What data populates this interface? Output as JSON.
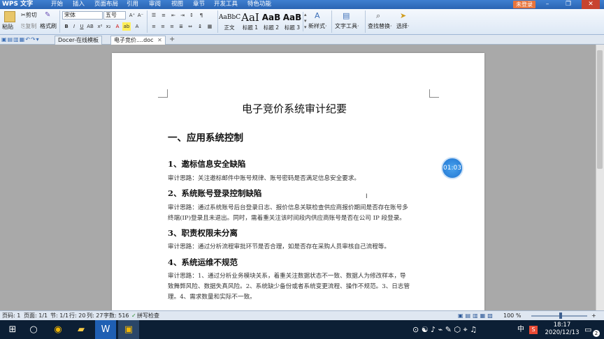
{
  "app": {
    "logo": "WPS 文字",
    "login": "未登录"
  },
  "menu": [
    "开始",
    "插入",
    "页面布局",
    "引用",
    "审阅",
    "视图",
    "章节",
    "开发工具",
    "特色功能"
  ],
  "window_controls": {
    "minimize": "–",
    "restore": "❐",
    "close": "✕"
  },
  "ribbon": {
    "paste": "粘贴",
    "cut": "剪切",
    "copy": "复制",
    "format_painter": "格式刷",
    "font_name": "宋体",
    "font_size": "五号",
    "styles": [
      {
        "preview": "AaBbC",
        "label": "正文"
      },
      {
        "preview": "AaI",
        "label": "标题 1"
      },
      {
        "preview": "AaB",
        "label": "标题 2"
      },
      {
        "preview": "AaB",
        "label": "标题 3"
      }
    ],
    "new_style": "新样式·",
    "text_tools": "文字工具·",
    "find_replace": "查找替换·",
    "select": "选择·"
  },
  "tabs": [
    {
      "label": "Docer-在线模板",
      "active": false
    },
    {
      "label": "电子竞价....doc",
      "active": true
    }
  ],
  "document": {
    "title": "电子竞价系统审计纪要",
    "section": "一、应用系统控制",
    "items": [
      {
        "heading": "1、邀标信息安全缺陷",
        "lines": [
          "审计思路：关注邀标邮件中账号规律、账号密码是否满足信息安全要求。"
        ]
      },
      {
        "heading": "2、系统账号登录控制缺陷",
        "lines": [
          "审计思路：通过系统账号后台登录日志、报价信息关联检查供应商报价期间是否存在账号多",
          "终端(IP)登录且未退出。同时，需着重关注该时间段内供应商账号是否在公司 IP 段登录。"
        ]
      },
      {
        "heading": "3、职责权限未分离",
        "lines": [
          "审计思路：通过分析流程审批环节是否合理，如是否存在采购人员审核自己流程等。"
        ]
      },
      {
        "heading": "4、系统运维不规范",
        "lines": [
          "审计思路：1、通过分析业务模块关系，着重关注数据状态不一致、数据人为修改样本，导",
          "致舞弊风险、数据失真风险。2、系统缺少备份或者系统变更流程、操作不规范。3、日志管",
          "理。4、需求数量和实际不一致。"
        ]
      }
    ]
  },
  "overlay": {
    "timer": "01:03"
  },
  "status": {
    "page_no": "页码: 1",
    "page": "页面: 1/1",
    "section": "节: 1/1",
    "row": "行: 20",
    "col": "列: 27",
    "words": "字数: 516",
    "spell": "拼写检查",
    "zoom": "100 %"
  },
  "taskbar": {
    "time": "18:17",
    "date": "2020/12/13",
    "ime": "中",
    "notifications": "2"
  }
}
